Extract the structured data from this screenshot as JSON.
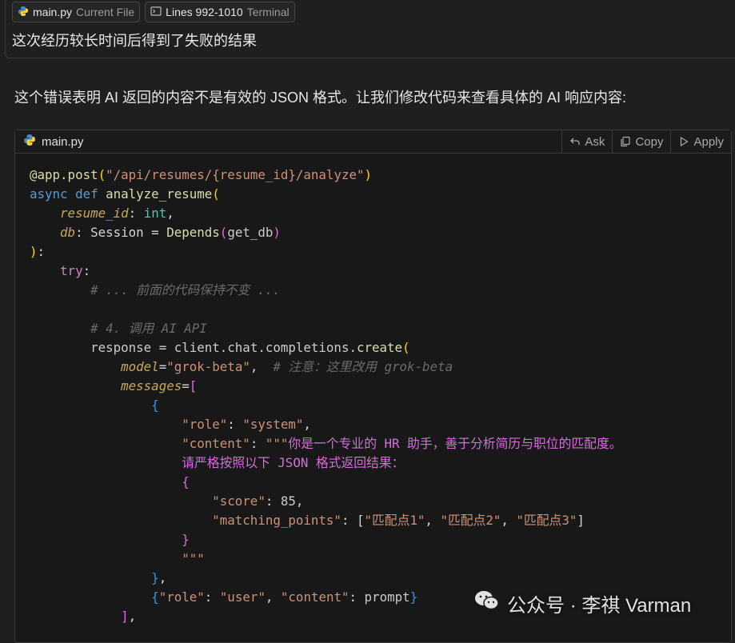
{
  "context_chips": [
    {
      "name": "main.py",
      "sub": "Current File",
      "icon": "python-icon"
    },
    {
      "name": "Lines 992-1010",
      "sub": "Terminal",
      "icon": "terminal-icon"
    }
  ],
  "user_message": "这次经历较长时间后得到了失败的结果",
  "assistant_message": "这个错误表明 AI 返回的内容不是有效的 JSON 格式。让我们修改代码来查看具体的 AI 响应内容:",
  "code_block": {
    "filename": "main.py",
    "file_icon": "python-icon",
    "actions": {
      "ask": "Ask",
      "copy": "Copy",
      "apply": "Apply"
    },
    "lines": [
      [
        [
          "dec",
          "@app.post"
        ],
        [
          "br1",
          "("
        ],
        [
          "str",
          "\"/api/resumes/{resume_id}/analyze\""
        ],
        [
          "br1",
          ")"
        ]
      ],
      [
        [
          "kw",
          "async def "
        ],
        [
          "fn",
          "analyze_resume"
        ],
        [
          "br1",
          "("
        ]
      ],
      [
        [
          "pu",
          "    "
        ],
        [
          "param",
          "resume_id"
        ],
        [
          "pu",
          ": "
        ],
        [
          "type",
          "int"
        ],
        [
          "pu",
          ","
        ]
      ],
      [
        [
          "pu",
          "    "
        ],
        [
          "param",
          "db"
        ],
        [
          "pu",
          ": Session = "
        ],
        [
          "fn",
          "Depends"
        ],
        [
          "br2",
          "("
        ],
        [
          "var",
          "get_db"
        ],
        [
          "br2",
          ")"
        ]
      ],
      [
        [
          "br1",
          ")"
        ],
        [
          "pu",
          ":"
        ]
      ],
      [
        [
          "pu",
          "    "
        ],
        [
          "ctrl",
          "try"
        ],
        [
          "pu",
          ":"
        ]
      ],
      [
        [
          "pu",
          "        "
        ],
        [
          "cmt",
          "# ... 前面的代码保持不变 ..."
        ]
      ],
      [
        [
          "pu",
          ""
        ]
      ],
      [
        [
          "pu",
          "        "
        ],
        [
          "cmt",
          "# 4. 调用 AI API"
        ]
      ],
      [
        [
          "pu",
          "        "
        ],
        [
          "var",
          "response = client.chat.completions."
        ],
        [
          "fn",
          "create"
        ],
        [
          "br1",
          "("
        ]
      ],
      [
        [
          "pu",
          "            "
        ],
        [
          "param",
          "model"
        ],
        [
          "pu",
          "="
        ],
        [
          "str",
          "\"grok-beta\""
        ],
        [
          "pu",
          ",  "
        ],
        [
          "cmt",
          "# 注意：这里改用 grok-beta"
        ]
      ],
      [
        [
          "pu",
          "            "
        ],
        [
          "param",
          "messages"
        ],
        [
          "pu",
          "="
        ],
        [
          "br2",
          "["
        ]
      ],
      [
        [
          "pu",
          "                "
        ],
        [
          "br3",
          "{"
        ]
      ],
      [
        [
          "pu",
          "                    "
        ],
        [
          "str",
          "\"role\""
        ],
        [
          "pu",
          ": "
        ],
        [
          "str",
          "\"system\""
        ],
        [
          "pu",
          ","
        ]
      ],
      [
        [
          "pu",
          "                    "
        ],
        [
          "str",
          "\"content\""
        ],
        [
          "pu",
          ": "
        ],
        [
          "str",
          "\"\"\""
        ],
        [
          "attr",
          "你是一个专业的 HR 助手，善于分析简历与职位的匹配度。"
        ]
      ],
      [
        [
          "attr",
          "                    请严格按照以下 JSON 格式返回结果："
        ]
      ],
      [
        [
          "attr",
          "                    {"
        ]
      ],
      [
        [
          "str",
          "                        \"score\""
        ],
        [
          "pu",
          ": "
        ],
        [
          "var",
          "85"
        ],
        [
          "pu",
          ","
        ]
      ],
      [
        [
          "str",
          "                        \"matching_points\""
        ],
        [
          "pu",
          ": "
        ],
        [
          "pu",
          "["
        ],
        [
          "str",
          "\"匹配点1\""
        ],
        [
          "pu",
          ", "
        ],
        [
          "str",
          "\"匹配点2\""
        ],
        [
          "pu",
          ", "
        ],
        [
          "str",
          "\"匹配点3\""
        ],
        [
          "pu",
          "]"
        ]
      ],
      [
        [
          "attr",
          "                    }"
        ]
      ],
      [
        [
          "str",
          "                    \"\"\""
        ]
      ],
      [
        [
          "pu",
          "                "
        ],
        [
          "br3",
          "}"
        ],
        [
          "pu",
          ","
        ]
      ],
      [
        [
          "pu",
          "                "
        ],
        [
          "br3",
          "{"
        ],
        [
          "str",
          "\"role\""
        ],
        [
          "pu",
          ": "
        ],
        [
          "str",
          "\"user\""
        ],
        [
          "pu",
          ", "
        ],
        [
          "str",
          "\"content\""
        ],
        [
          "pu",
          ": "
        ],
        [
          "var",
          "prompt"
        ],
        [
          "br3",
          "}"
        ]
      ],
      [
        [
          "pu",
          "            "
        ],
        [
          "br2",
          "]"
        ],
        [
          "pu",
          ","
        ]
      ]
    ]
  },
  "watermark": "公众号 · 李祺 Varman",
  "colors": {
    "background": "#1f1f1f",
    "code_background": "#181818",
    "border": "#3a3a3a"
  }
}
